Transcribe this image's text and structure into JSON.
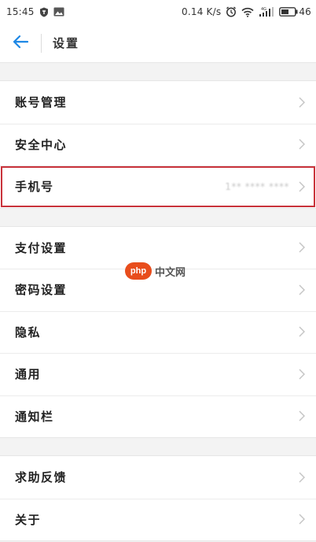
{
  "status_bar": {
    "time": "15:45",
    "net_speed": "0.14 K/s",
    "network_type": "4G",
    "battery": "46",
    "icons": [
      "shield-badge-icon",
      "image-icon",
      "alarm-icon",
      "wifi-icon",
      "signal-icon",
      "battery-icon"
    ]
  },
  "header": {
    "title": "设置",
    "back_icon": "back-arrow-icon",
    "accent_color": "#1e88e5"
  },
  "groups": [
    {
      "items": [
        {
          "label": "账号管理",
          "value": ""
        },
        {
          "label": "安全中心",
          "value": ""
        },
        {
          "label": "手机号",
          "value": "1** **** ****",
          "highlighted": true
        }
      ]
    },
    {
      "items": [
        {
          "label": "支付设置",
          "value": ""
        },
        {
          "label": "密码设置",
          "value": ""
        },
        {
          "label": "隐私",
          "value": ""
        },
        {
          "label": "通用",
          "value": ""
        },
        {
          "label": "通知栏",
          "value": ""
        }
      ]
    },
    {
      "items": [
        {
          "label": "求助反馈",
          "value": ""
        },
        {
          "label": "关于",
          "value": ""
        }
      ]
    }
  ],
  "watermark": {
    "badge": "php",
    "text": "中文网",
    "badge_color": "#e84d1c"
  },
  "highlight_color": "#c8323a"
}
